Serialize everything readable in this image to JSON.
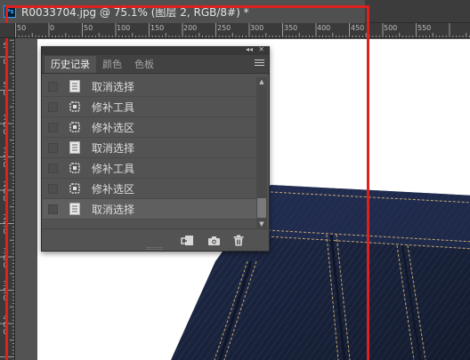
{
  "app": {
    "icon_text": "Ps",
    "doc_tab_title": "R0033704.jpg @ 75.1% (图层 2, RGB/8#) *"
  },
  "ruler": {
    "h_labels": [
      "50",
      "0",
      "50",
      "100",
      "150",
      "200",
      "250",
      "300",
      "350",
      "400",
      "450",
      "500",
      "550"
    ],
    "v_labels": [
      "5",
      "0",
      "5",
      "0",
      "1 0 0",
      "1 5 0",
      "2 0 0",
      "2 5 0",
      "3 0 0",
      "3 5 0",
      "4 0 0"
    ]
  },
  "history_panel": {
    "tabs": [
      "历史记录",
      "颜色",
      "色板"
    ],
    "active_tab": "历史记录",
    "entries": [
      {
        "label": "取消选择",
        "icon": "document-icon",
        "current": false
      },
      {
        "label": "修补工具",
        "icon": "patch-tool-icon",
        "current": false
      },
      {
        "label": "修补选区",
        "icon": "patch-tool-icon",
        "current": false
      },
      {
        "label": "取消选择",
        "icon": "document-icon",
        "current": false
      },
      {
        "label": "修补工具",
        "icon": "patch-tool-icon",
        "current": false
      },
      {
        "label": "修补选区",
        "icon": "patch-tool-icon",
        "current": false
      },
      {
        "label": "取消选择",
        "icon": "document-icon",
        "current": true
      }
    ],
    "footer_buttons": [
      "new-document-from-state-icon",
      "camera-icon",
      "trash-icon"
    ]
  },
  "colors": {
    "highlight_frame": "#e0201d",
    "panel_bg": "#535353",
    "denim": "#1f2a47"
  }
}
